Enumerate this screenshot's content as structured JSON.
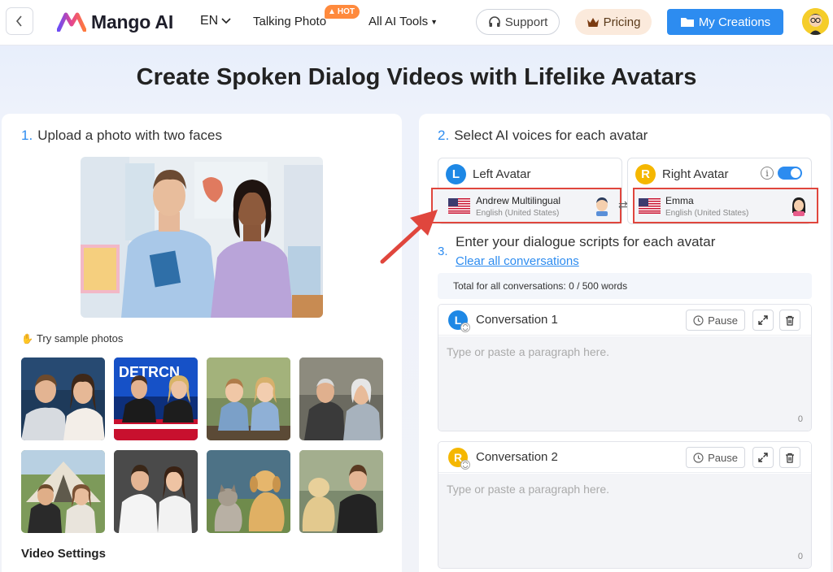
{
  "nav": {
    "logo_text": "Mango AI",
    "lang": "EN",
    "talking_photo": "Talking Photo",
    "hot_badge": "HOT",
    "ai_tools": "All AI Tools",
    "support": "Support",
    "pricing": "Pricing",
    "my_creations": "My Creations"
  },
  "page_title": "Create Spoken Dialog Videos with Lifelike Avatars",
  "step1": {
    "num": "1.",
    "title": "Upload a photo with two faces",
    "sample_label": "Try sample photos",
    "video_settings": "Video Settings"
  },
  "step2": {
    "num": "2.",
    "title": "Select AI voices for each avatar",
    "left": {
      "letter": "L",
      "title": "Left Avatar",
      "voice_name": "Andrew Multilingual",
      "voice_lang": "English (United States)"
    },
    "right": {
      "letter": "R",
      "title": "Right Avatar",
      "voice_name": "Emma",
      "voice_lang": "English (United States)"
    },
    "toggle_on": true
  },
  "step3": {
    "num": "3.",
    "title": "Enter your dialogue scripts for each avatar",
    "clear_link": "Clear all conversations",
    "total": "Total for all conversations: 0 / 500 words",
    "conversations": [
      {
        "letter": "L",
        "title": "Conversation 1",
        "pause": "Pause",
        "placeholder": "Type or paste a paragraph here.",
        "count": "0"
      },
      {
        "letter": "R",
        "title": "Conversation 2",
        "pause": "Pause",
        "placeholder": "Type or paste a paragraph here.",
        "count": "0"
      }
    ]
  },
  "colors": {
    "accent": "#2d8cf0",
    "highlight": "#e0463d",
    "left_avatar": "#1e88e5",
    "right_avatar": "#f5b700"
  }
}
